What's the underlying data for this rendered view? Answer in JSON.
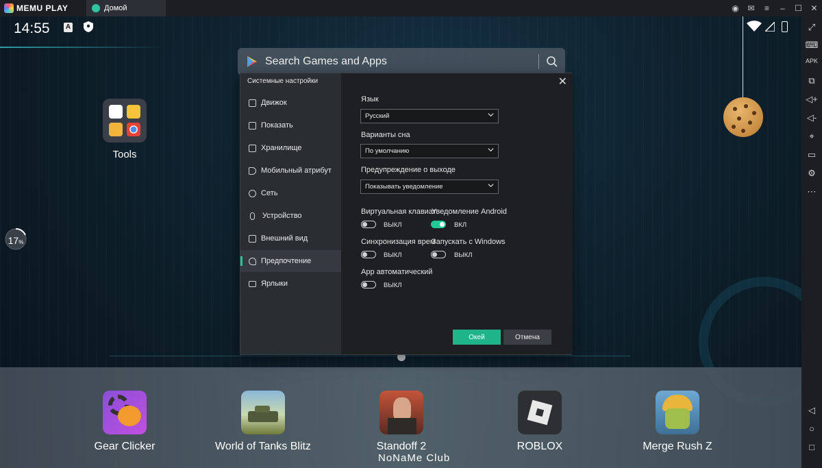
{
  "titlebar": {
    "brand": "MEMU PLAY",
    "tab_label": "Домой"
  },
  "statusbar": {
    "time": "14:55",
    "a_icon": "A"
  },
  "search": {
    "placeholder": "Search Games and Apps"
  },
  "desktop": {
    "folder_label": "Tools",
    "progress_percent": "17",
    "progress_suffix": "%"
  },
  "settings_dialog": {
    "title": "Системные настройки",
    "nav": [
      {
        "label": "Движок",
        "icon": "chip-icon"
      },
      {
        "label": "Показать",
        "icon": "monitor-icon"
      },
      {
        "label": "Хранилище",
        "icon": "storage-icon"
      },
      {
        "label": "Мобильный атрибут",
        "icon": "tag-icon"
      },
      {
        "label": "Сеть",
        "icon": "globe-icon"
      },
      {
        "label": "Устройство",
        "icon": "mic-icon"
      },
      {
        "label": "Внешний вид",
        "icon": "appearance-icon"
      },
      {
        "label": "Предпочтение",
        "icon": "wrench-icon"
      },
      {
        "label": "Ярлыки",
        "icon": "keyboard-icon"
      }
    ],
    "active_nav": "Предпочтение",
    "language_label": "Язык",
    "language_value": "Русский",
    "sleep_label": "Варианты сна",
    "sleep_value": "По умолчанию",
    "exit_label": "Предупреждение о выходе",
    "exit_value": "Показывать уведомление",
    "virtual_keyboard_label": "Виртуальная клавиат",
    "virtual_keyboard_state": "ВЫКЛ",
    "android_notify_label": "Уведомление Android",
    "android_notify_state": "ВКЛ",
    "time_sync_label": "Синхронизация врем",
    "time_sync_state": "ВЫКЛ",
    "start_windows_label": "Запускать с Windows",
    "start_windows_state": "ВЫКЛ",
    "app_auto_label": "App автоматический",
    "app_auto_state": "ВЫКЛ",
    "ok_label": "Окей",
    "cancel_label": "Отмена"
  },
  "dock": {
    "apps": [
      {
        "label": "Gear Clicker"
      },
      {
        "label": "World of Tanks Blitz"
      },
      {
        "label": "Standoff 2"
      },
      {
        "label": "ROBLOX"
      },
      {
        "label": "Merge Rush Z"
      }
    ],
    "watermark": "NoNaMe Club"
  },
  "colors": {
    "accent": "#20c997",
    "dialog_bg": "#1d1f22",
    "sidebar_bg": "#2a2d31"
  }
}
